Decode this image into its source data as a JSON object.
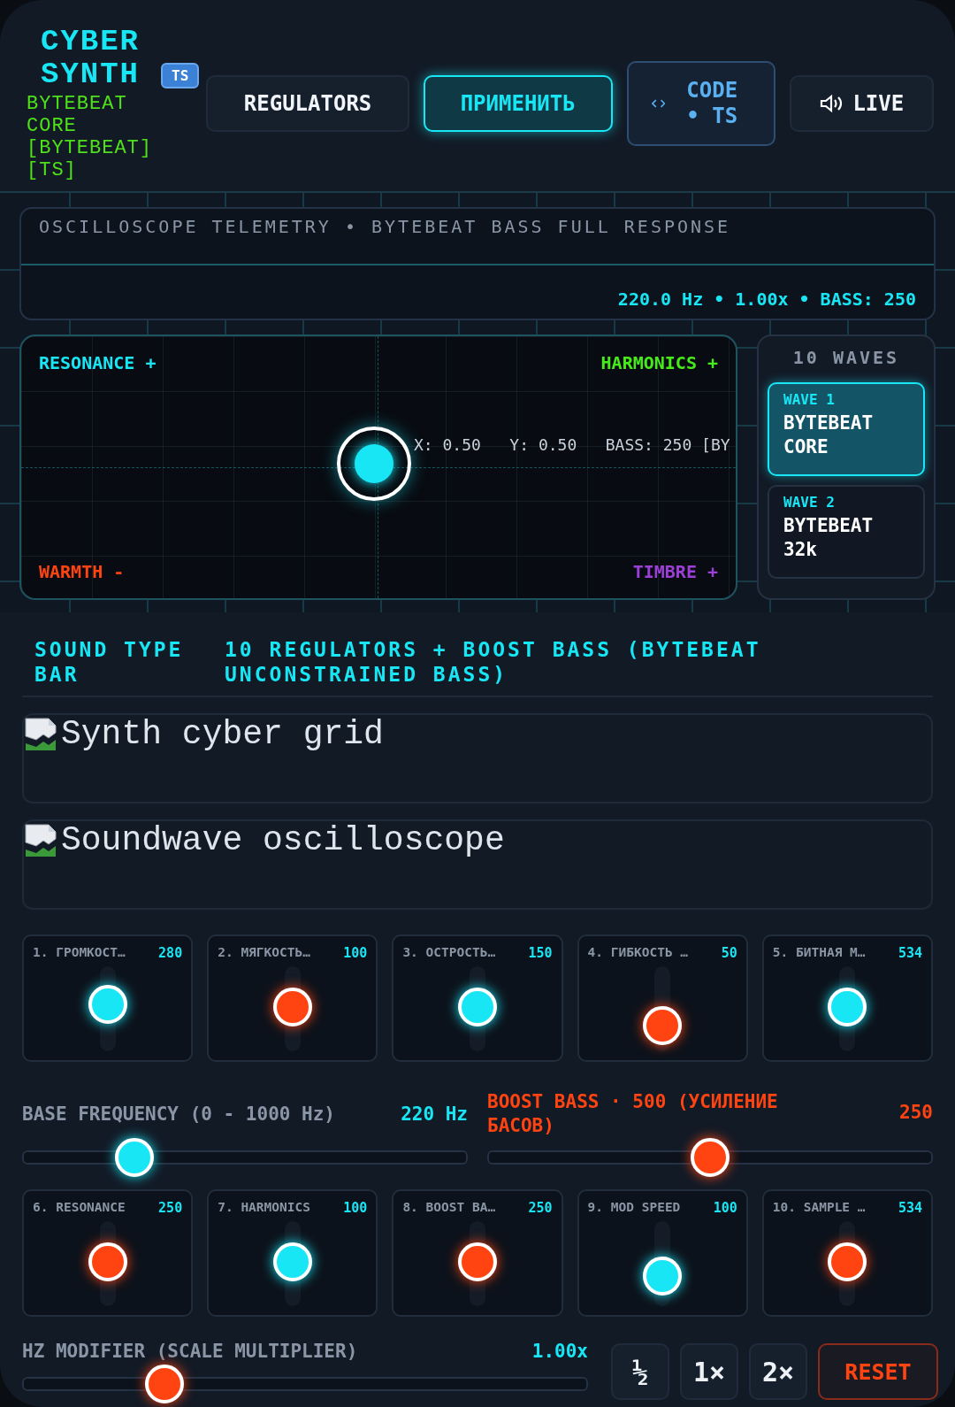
{
  "logo": {
    "title_lines": [
      "CYBER",
      "SYNTH"
    ],
    "badge": "TS",
    "subtitle_lines": [
      "BYTEBEAT",
      "CORE",
      "[BYTEBEAT]",
      "[TS]"
    ]
  },
  "header_buttons": [
    {
      "kind": "plain",
      "label": "REGULATORS"
    },
    {
      "kind": "active",
      "label": "ПРИМЕНИТЬ"
    },
    {
      "kind": "code",
      "label": "CODE • TS"
    },
    {
      "kind": "sound",
      "label": "LIVE"
    }
  ],
  "telemetry": {
    "title": "OSCILLOSCOPE TELEMETRY • BYTEBEAT BASS FULL RESPONSE",
    "readout": "220.0 Hz • 1.00x • BASS: 250"
  },
  "xy_pad": {
    "corners": [
      "RESONANCE +",
      "HARMONICS +",
      "WARMTH -",
      "TIMBRE +"
    ],
    "readout": "X: 0.50   Y: 0.50   BASS: 250 [BY"
  },
  "waves": {
    "title": "10 WAVES",
    "items": [
      {
        "tag": "WAVE 1",
        "name": "BYTEBEAT CORE",
        "selected": true
      },
      {
        "tag": "WAVE 2",
        "name": "BYTEBEAT 32k",
        "selected": false
      }
    ]
  },
  "sound_type": {
    "label": "SOUND TYPE BAR",
    "value": "10 REGULATORS + BOOST BASS (BYTEBEAT UNCONSTRAINED BASS)"
  },
  "broken_images": [
    "Synth cyber grid",
    "Soundwave oscilloscope"
  ],
  "knobs_row_1": [
    {
      "label": "1. ГРОМКОСТ…",
      "value": "280",
      "level": 0.55,
      "color": "#19e6f5"
    },
    {
      "label": "2. МЯГКОСТЬ…",
      "value": "100",
      "level": 0.52,
      "color": "#ff4412"
    },
    {
      "label": "3. ОСТРОСТЬ…",
      "value": "150",
      "level": 0.52,
      "color": "#19e6f5"
    },
    {
      "label": "4. ГИБКОСТЬ …",
      "value": "50",
      "level": 0.3,
      "color": "#ff4412"
    },
    {
      "label": "5. БИТНАЯ М…",
      "value": "534",
      "level": 0.52,
      "color": "#19e6f5"
    }
  ],
  "base_frequency": {
    "label": "BASE FREQUENCY (0 - 1000 Hz)",
    "value": "220 Hz",
    "level": 0.25
  },
  "boost_bass": {
    "label": "BOOST BASS · 500 (УСИЛЕНИЕ БАСОВ)",
    "value": "250",
    "level": 0.5
  },
  "knobs_row_2": [
    {
      "label": "6. RESONANCE",
      "value": "250",
      "level": 0.52,
      "color": "#ff4412"
    },
    {
      "label": "7. HARMONICS",
      "value": "100",
      "level": 0.52,
      "color": "#19e6f5"
    },
    {
      "label": "8. BOOST BA…",
      "value": "250",
      "level": 0.52,
      "color": "#ff4412"
    },
    {
      "label": "9. MOD SPEED",
      "value": "100",
      "level": 0.35,
      "color": "#19e6f5"
    },
    {
      "label": "10. SAMPLE …",
      "value": "534",
      "level": 0.52,
      "color": "#ff4412"
    }
  ],
  "hz_modifier": {
    "label": "HZ MODIFIER (SCALE MULTIPLIER)",
    "value": "1.00x",
    "level": 0.25
  },
  "multiplier_buttons": [
    {
      "kind": "plain",
      "label": "½"
    },
    {
      "kind": "plain",
      "label": "1×"
    },
    {
      "kind": "plain",
      "label": "2×"
    },
    {
      "kind": "danger",
      "label": "RESET"
    }
  ]
}
